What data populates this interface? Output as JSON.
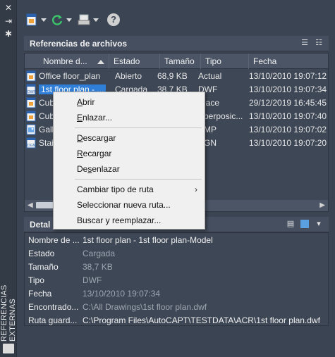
{
  "palette": {
    "desktop_bg": "#3b4453",
    "selection": "#2f7ed8",
    "menu_bg": "#f0f0f0"
  },
  "sidebar": {
    "title": "REFERENCIAS EXTERNAS",
    "icons": [
      "close-icon",
      "pin-icon",
      "settings-icon"
    ]
  },
  "toolbar": {
    "buttons": [
      "attach-dwg-icon",
      "refresh-icon",
      "change-path-icon",
      "help-icon"
    ],
    "help_label": "?"
  },
  "files": {
    "title": "Referencias de archivos",
    "columns": [
      "Nombre d...",
      "Estado",
      "Tamaño",
      "Tipo",
      "Fecha"
    ],
    "rows": [
      {
        "icon": "dwg-file-icon",
        "name": "Office floor_plan",
        "status": "Abierto",
        "size": "68,9 KB",
        "type": "Actual",
        "date": "13/10/2010 19:07:12"
      },
      {
        "icon": "dwf-file-icon",
        "name": "1st floor plan - ...",
        "status": "Cargada",
        "size": "38,7 KB",
        "type": "DWF",
        "date": "13/10/2010 19:07:34",
        "selected": true
      },
      {
        "icon": "dwg-file-icon",
        "name": "Cub",
        "status": "",
        "size": "",
        "type": "lace",
        "date": "29/12/2019 16:45:45"
      },
      {
        "icon": "dwg-file-icon",
        "name": "Cub",
        "status": "",
        "size": "",
        "type": "perposic...",
        "date": "13/10/2010 19:07:40"
      },
      {
        "icon": "image-file-icon",
        "name": "Gall",
        "status": "",
        "size": "",
        "type": "MP",
        "date": "13/10/2010 19:07:02"
      },
      {
        "icon": "dgn-file-icon",
        "name": "Stai",
        "status": "",
        "size": "",
        "type": "GN",
        "date": "13/10/2010 19:07:20"
      }
    ]
  },
  "details": {
    "title": "Detal",
    "rows": [
      {
        "label": "Nombre de ...",
        "value": "1st floor plan - 1st floor plan-Model",
        "bright": true
      },
      {
        "label": "Estado",
        "value": "Cargada",
        "bright": false
      },
      {
        "label": "Tamaño",
        "value": "38,7 KB",
        "bright": false
      },
      {
        "label": "Tipo",
        "value": "DWF",
        "bright": false
      },
      {
        "label": "Fecha",
        "value": "13/10/2010 19:07:34",
        "bright": false
      },
      {
        "label": "Encontrado...",
        "value": "C:\\All Drawings\\1st floor plan.dwf",
        "bright": false
      },
      {
        "label": "Ruta guard...",
        "value": "C:\\Program Files\\AutoCAPT\\TESTDATA\\ACR\\1st floor plan.dwf",
        "bright": true
      }
    ]
  },
  "context_menu": {
    "items": [
      {
        "label": "Abrir",
        "accel": "A",
        "rest": "brir"
      },
      {
        "label": "Enlazar...",
        "accel": "E",
        "rest": "nlazar..."
      },
      {
        "label": "Descargar",
        "accel": "D",
        "rest": "escargar"
      },
      {
        "label": "Recargar",
        "accel": "R",
        "rest": "ecargar"
      },
      {
        "label": "Desenlazar",
        "pre": "De",
        "accel": "s",
        "rest": "enlazar"
      },
      {
        "label": "Cambiar tipo de ruta",
        "submenu": true
      },
      {
        "label": "Seleccionar nueva ruta..."
      },
      {
        "label": "Buscar y reemplazar..."
      }
    ],
    "submenu_glyph": "›"
  }
}
